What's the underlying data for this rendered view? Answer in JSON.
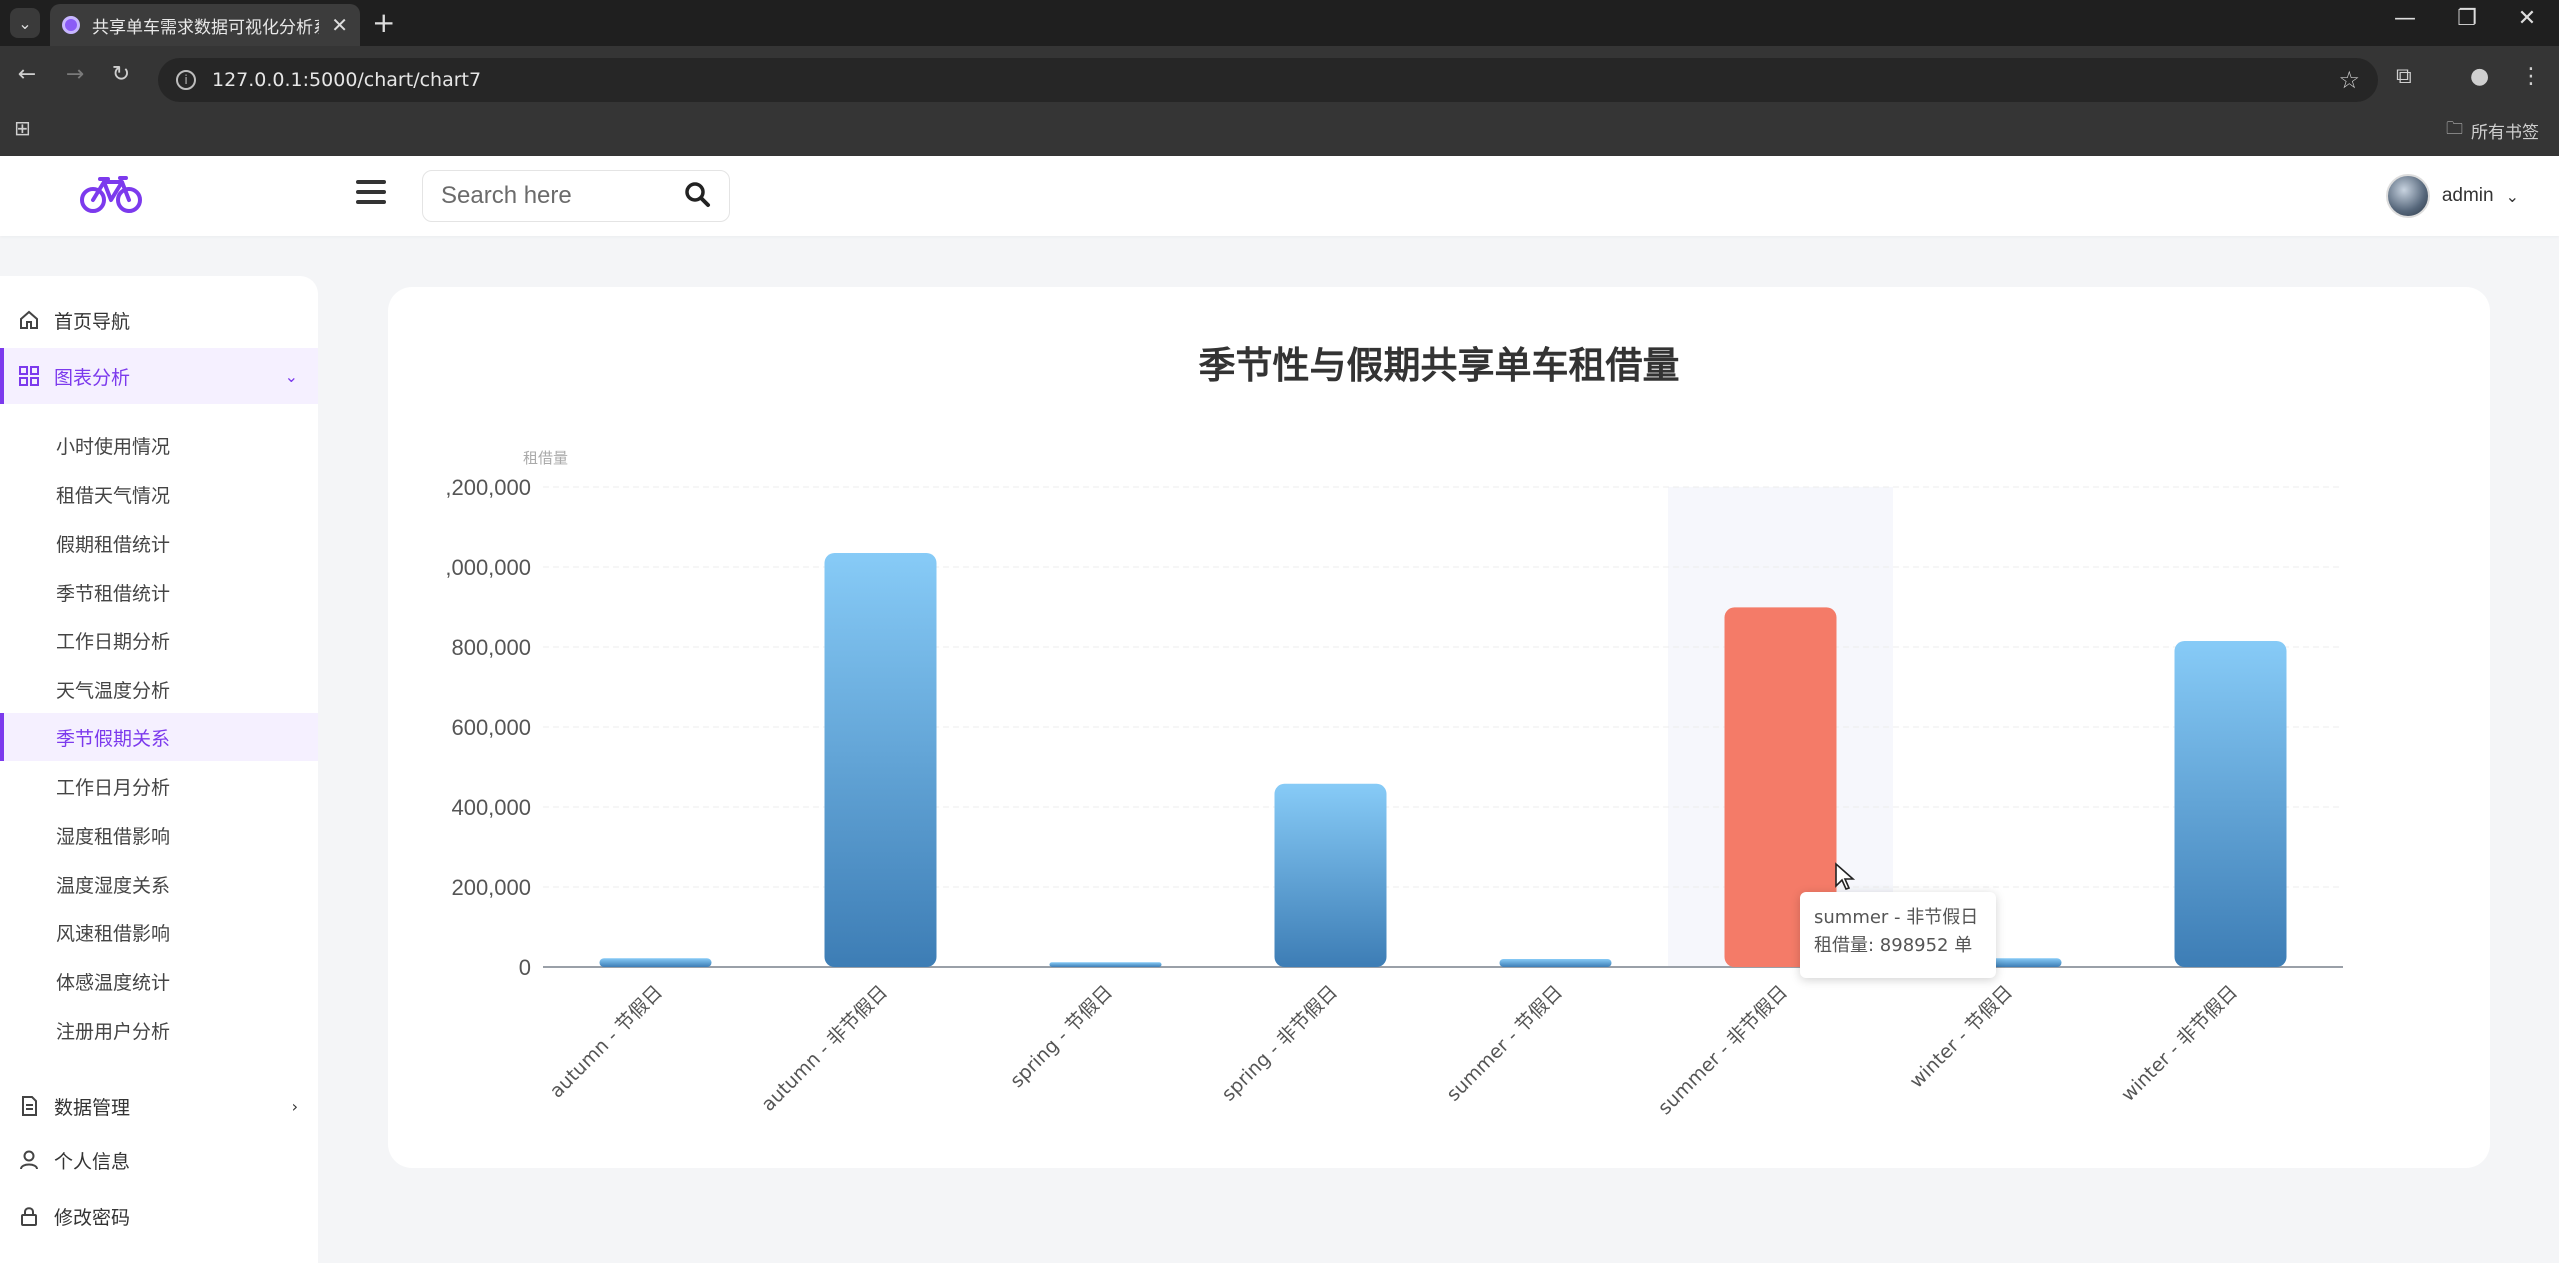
{
  "browser": {
    "tab_title": "共享单车需求数据可视化分析系",
    "url": "127.0.0.1:5000/chart/chart7",
    "bookmarks_folder": "所有书签"
  },
  "header": {
    "search_placeholder": "Search here",
    "username": "admin"
  },
  "sidebar": {
    "items": [
      {
        "label": "首页导航"
      },
      {
        "label": "图表分析"
      },
      {
        "label": "数据管理"
      },
      {
        "label": "个人信息"
      },
      {
        "label": "修改密码"
      }
    ],
    "sub_items": [
      {
        "label": "小时使用情况"
      },
      {
        "label": "租借天气情况"
      },
      {
        "label": "假期租借统计"
      },
      {
        "label": "季节租借统计"
      },
      {
        "label": "工作日期分析"
      },
      {
        "label": "天气温度分析"
      },
      {
        "label": "季节假期关系"
      },
      {
        "label": "工作日月分析"
      },
      {
        "label": "湿度租借影响"
      },
      {
        "label": "温度湿度关系"
      },
      {
        "label": "风速租借影响"
      },
      {
        "label": "体感温度统计"
      },
      {
        "label": "注册用户分析"
      }
    ]
  },
  "colors": {
    "accent": "#7c3aed",
    "bar_top": "#87cbf7",
    "bar_bottom": "#3d7db5",
    "highlight": "#f47b68"
  },
  "chart_data": {
    "type": "bar",
    "title": "季节性与假期共享单车租借量",
    "ylabel": "租借量",
    "ylim": [
      0,
      1200000
    ],
    "ytick_labels": [
      "0",
      "200,000",
      "400,000",
      "600,000",
      "800,000",
      ",000,000",
      ",200,000"
    ],
    "categories": [
      "autumn - 节假日",
      "autumn - 非节假日",
      "spring - 节假日",
      "spring - 非节假日",
      "summer - 节假日",
      "summer - 非节假日",
      "winter - 节假日",
      "winter - 非节假日"
    ],
    "values": [
      22000,
      1035000,
      12000,
      458000,
      20000,
      898952,
      22000,
      815000
    ],
    "highlight_index": 5,
    "tooltip": {
      "title": "summer - 非节假日",
      "label": "租借量: 898952 单"
    }
  }
}
